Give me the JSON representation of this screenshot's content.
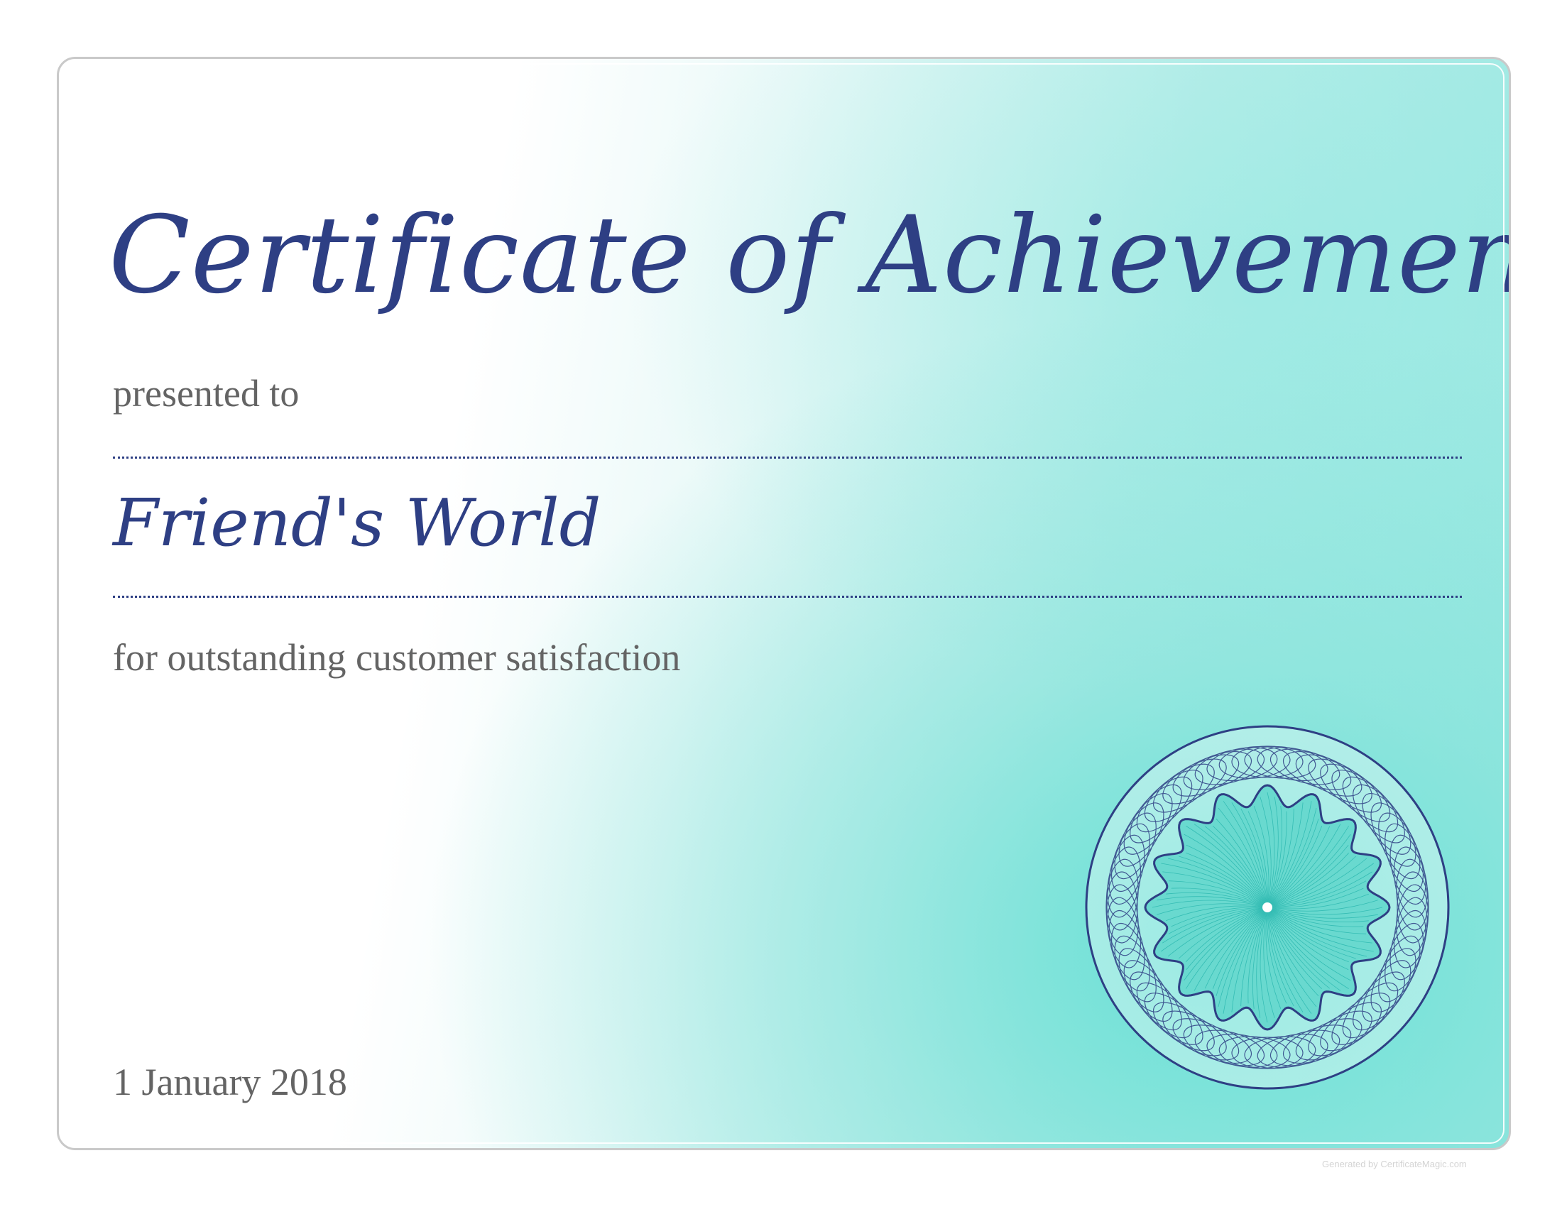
{
  "certificate": {
    "title": "Certificate of Achievement",
    "presented_label": "presented to",
    "recipient": "Friend's World",
    "reason": "for outstanding customer satisfaction",
    "date": "1 January 2018"
  },
  "footer": {
    "credit": "Generated by CertificateMagic.com"
  },
  "colors": {
    "primary_text": "#2e3f84",
    "secondary_text": "#646464",
    "accent": "#5cded2",
    "border": "#c9c9c9"
  },
  "icons": {
    "seal": "guilloche-seal-icon"
  }
}
